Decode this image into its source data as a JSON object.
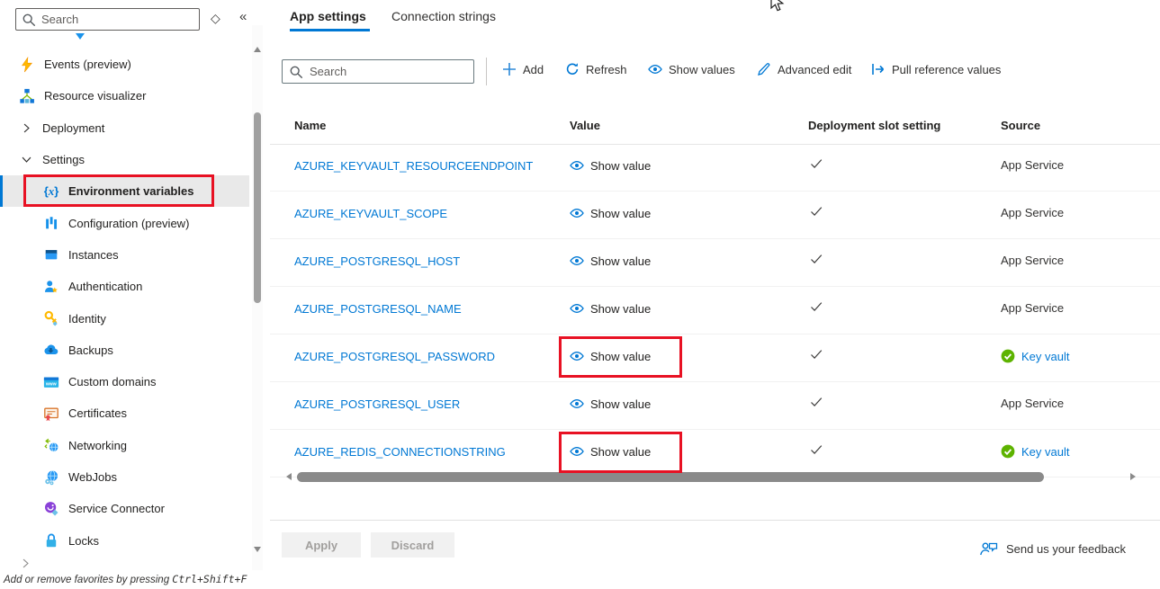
{
  "sidebar": {
    "search_placeholder": "Search",
    "header_icons": [
      {
        "name": "pin-icon"
      },
      {
        "name": "collapse-sidebar-icon"
      }
    ],
    "items": [
      {
        "label": "Events (preview)",
        "icon": "lightning-icon",
        "level": "top"
      },
      {
        "label": "Resource visualizer",
        "icon": "resource-tree-icon",
        "level": "top"
      },
      {
        "label": "Deployment",
        "icon": "chevron-right-icon",
        "level": "group"
      },
      {
        "label": "Settings",
        "icon": "chevron-down-icon",
        "level": "group"
      },
      {
        "label": "Environment variables",
        "icon": "braces-x-icon",
        "level": "sub",
        "selected": true,
        "annotated": true
      },
      {
        "label": "Configuration (preview)",
        "icon": "configuration-bars-icon",
        "level": "sub"
      },
      {
        "label": "Instances",
        "icon": "instances-icon",
        "level": "sub"
      },
      {
        "label": "Authentication",
        "icon": "authentication-person-icon",
        "level": "sub"
      },
      {
        "label": "Identity",
        "icon": "identity-key-icon",
        "level": "sub"
      },
      {
        "label": "Backups",
        "icon": "backups-cloud-icon",
        "level": "sub"
      },
      {
        "label": "Custom domains",
        "icon": "custom-domains-www-icon",
        "level": "sub"
      },
      {
        "label": "Certificates",
        "icon": "certificates-icon",
        "level": "sub"
      },
      {
        "label": "Networking",
        "icon": "networking-globe-icon",
        "level": "sub"
      },
      {
        "label": "WebJobs",
        "icon": "webjobs-globe-icon",
        "level": "sub"
      },
      {
        "label": "Service Connector",
        "icon": "service-connector-icon",
        "level": "sub"
      },
      {
        "label": "Locks",
        "icon": "lock-icon",
        "level": "sub"
      }
    ],
    "footer_hint_prefix": "Add or remove favorites by pressing ",
    "footer_hint_shortcut": "Ctrl+Shift+F"
  },
  "tabs": [
    {
      "label": "App settings",
      "active": true
    },
    {
      "label": "Connection strings",
      "active": false
    }
  ],
  "toolbar": {
    "search_placeholder": "Search",
    "buttons": [
      {
        "label": "Add",
        "icon": "plus-icon"
      },
      {
        "label": "Refresh",
        "icon": "refresh-icon"
      },
      {
        "label": "Show values",
        "icon": "eye-icon"
      },
      {
        "label": "Advanced edit",
        "icon": "pencil-icon"
      },
      {
        "label": "Pull reference values",
        "icon": "pull-arrow-icon"
      }
    ]
  },
  "table": {
    "columns": [
      "Name",
      "Value",
      "Deployment slot setting",
      "Source"
    ],
    "slot_check_icon": "checkmark-icon",
    "key_vault_badge_icon": "key-vault-badge-icon",
    "value_eye_icon": "eye-icon",
    "rows": [
      {
        "name": "AZURE_KEYVAULT_RESOURCEENDPOINT",
        "value_label": "Show value",
        "slot_checked": true,
        "source": "App Service",
        "source_kind": "app-service",
        "annotated": false
      },
      {
        "name": "AZURE_KEYVAULT_SCOPE",
        "value_label": "Show value",
        "slot_checked": true,
        "source": "App Service",
        "source_kind": "app-service",
        "annotated": false
      },
      {
        "name": "AZURE_POSTGRESQL_HOST",
        "value_label": "Show value",
        "slot_checked": true,
        "source": "App Service",
        "source_kind": "app-service",
        "annotated": false
      },
      {
        "name": "AZURE_POSTGRESQL_NAME",
        "value_label": "Show value",
        "slot_checked": true,
        "source": "App Service",
        "source_kind": "app-service",
        "annotated": false
      },
      {
        "name": "AZURE_POSTGRESQL_PASSWORD",
        "value_label": "Show value",
        "slot_checked": true,
        "source": "Key vault",
        "source_kind": "key-vault",
        "annotated": true
      },
      {
        "name": "AZURE_POSTGRESQL_USER",
        "value_label": "Show value",
        "slot_checked": true,
        "source": "App Service",
        "source_kind": "app-service",
        "annotated": false
      },
      {
        "name": "AZURE_REDIS_CONNECTIONSTRING",
        "value_label": "Show value",
        "slot_checked": true,
        "source": "Key vault",
        "source_kind": "key-vault",
        "annotated": true
      }
    ]
  },
  "footer": {
    "apply": "Apply",
    "discard": "Discard",
    "feedback": "Send us your feedback",
    "feedback_icon": "feedback-person-icon"
  },
  "colors": {
    "accent": "#0078d4",
    "annotation_red": "#e81123",
    "key_vault_green": "#5db300",
    "selected_item_bg": "#e9e9e9"
  }
}
